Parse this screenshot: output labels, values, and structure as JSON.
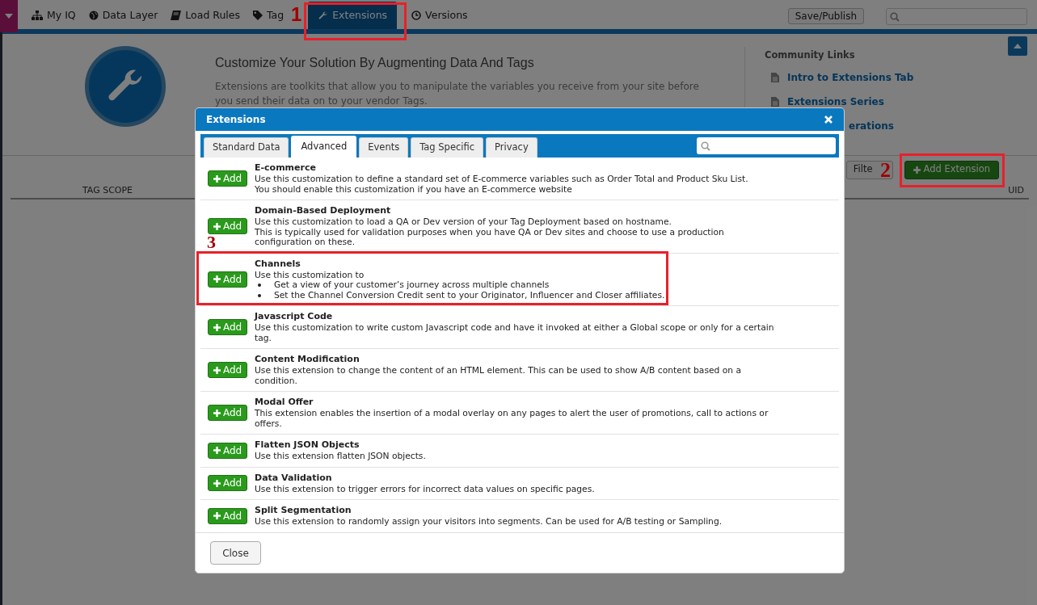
{
  "nav": {
    "tabs": [
      {
        "label": "My IQ",
        "selected": false
      },
      {
        "label": "Data Layer",
        "selected": false
      },
      {
        "label": "Load Rules",
        "selected": false
      },
      {
        "label": "Tag",
        "selected": false
      },
      {
        "label": "Extensions",
        "selected": true
      },
      {
        "label": "Versions",
        "selected": false
      }
    ],
    "save_button": "Save/Publish"
  },
  "intro": {
    "heading": "Customize Your Solution By Augmenting Data And Tags",
    "text": "Extensions are toolkits that allow you to manipulate the variables you receive from your site before you send their data on to your vendor Tags."
  },
  "community": {
    "title": "Community Links",
    "links": [
      "Intro to Extensions Tab",
      "Extensions Series",
      "erations"
    ]
  },
  "toolbar": {
    "filter": "Filte",
    "add": "Add Extension"
  },
  "table": {
    "columns": [
      "TAG SCOPE",
      "UID"
    ]
  },
  "modal": {
    "title": "Extensions",
    "tabs": [
      {
        "label": "Standard Data",
        "selected": false
      },
      {
        "label": "Advanced",
        "selected": true
      },
      {
        "label": "Events",
        "selected": false
      },
      {
        "label": "Tag Specific",
        "selected": false
      },
      {
        "label": "Privacy",
        "selected": false
      }
    ],
    "items": [
      {
        "button": "Add",
        "title": "E-commerce",
        "lines": [
          "Use this customization to define a standard set of E-commerce variables such as Order Total and Product Sku List.",
          "You should enable this customization if you have an E-commerce website"
        ]
      },
      {
        "button": "Add",
        "title": "Domain-Based Deployment",
        "lines": [
          "Use this customization to load a QA or Dev version of your Tag Deployment based on hostname.",
          "This is typically used for validation purposes when you have QA or Dev sites and choose to use a production configuration on these."
        ]
      },
      {
        "button": "Add",
        "title": "Channels",
        "lines": [
          "Use this customization to"
        ],
        "bullets": [
          "Get a view of your customer’s journey across multiple channels",
          "Set the Channel Conversion Credit sent to your Originator, Influencer and Closer affiliates."
        ]
      },
      {
        "button": "Add",
        "title": "Javascript Code",
        "lines": [
          "Use this customization to write custom Javascript code and have it invoked at either a Global scope or only for a certain tag."
        ]
      },
      {
        "button": "Add",
        "title": "Content Modification",
        "lines": [
          "Use this extension to change the content of an HTML element. This can be used to show A/B content based on a condition."
        ]
      },
      {
        "button": "Add",
        "title": "Modal Offer",
        "lines": [
          "This extension enables the insertion of a modal overlay on any pages to alert the user of promotions, call to actions or offers."
        ]
      },
      {
        "button": "Add",
        "title": "Flatten JSON Objects",
        "lines": [
          "Use this extension flatten JSON objects."
        ]
      },
      {
        "button": "Add",
        "title": "Data Validation",
        "lines": [
          "Use this extension to trigger errors for incorrect data values on specific pages."
        ]
      },
      {
        "button": "Add",
        "title": "Split Segmentation",
        "lines": [
          "Use this extension to randomly assign your visitors into segments. Can be used for A/B testing or Sampling."
        ]
      }
    ],
    "close": "Close"
  },
  "annotations": [
    {
      "label": "1"
    },
    {
      "label": "2"
    },
    {
      "label": "3"
    }
  ]
}
